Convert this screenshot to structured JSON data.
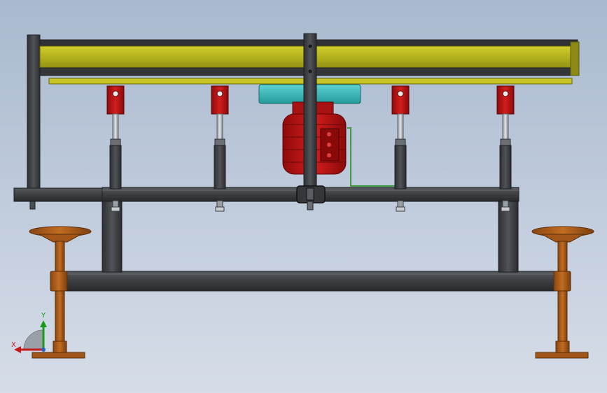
{
  "view": {
    "background_top": "#a9b9cf",
    "background_bottom": "#d6dde8"
  },
  "colors": {
    "frame_steel": "#3d3f42",
    "frame_edge": "#1f2022",
    "yellow_beam": "#b4b21e",
    "yellow_dark": "#7c7a12",
    "red_part": "#b81414",
    "red_dark": "#6f0808",
    "teal_part": "#39b8b8",
    "orange_stand": "#b05e1a",
    "orange_dark": "#6f3a0c",
    "wire_green": "#3f9a3f"
  },
  "triad": {
    "x_label": "X",
    "y_label": "Y",
    "x_color": "#c41a1a",
    "y_color": "#1a9a1a"
  },
  "parts": {
    "beam": "yellow-beam",
    "motor": "gear-motor",
    "clevis": "clevis-bracket",
    "rod": "cylinder-rod",
    "stand": "roller-stand"
  }
}
